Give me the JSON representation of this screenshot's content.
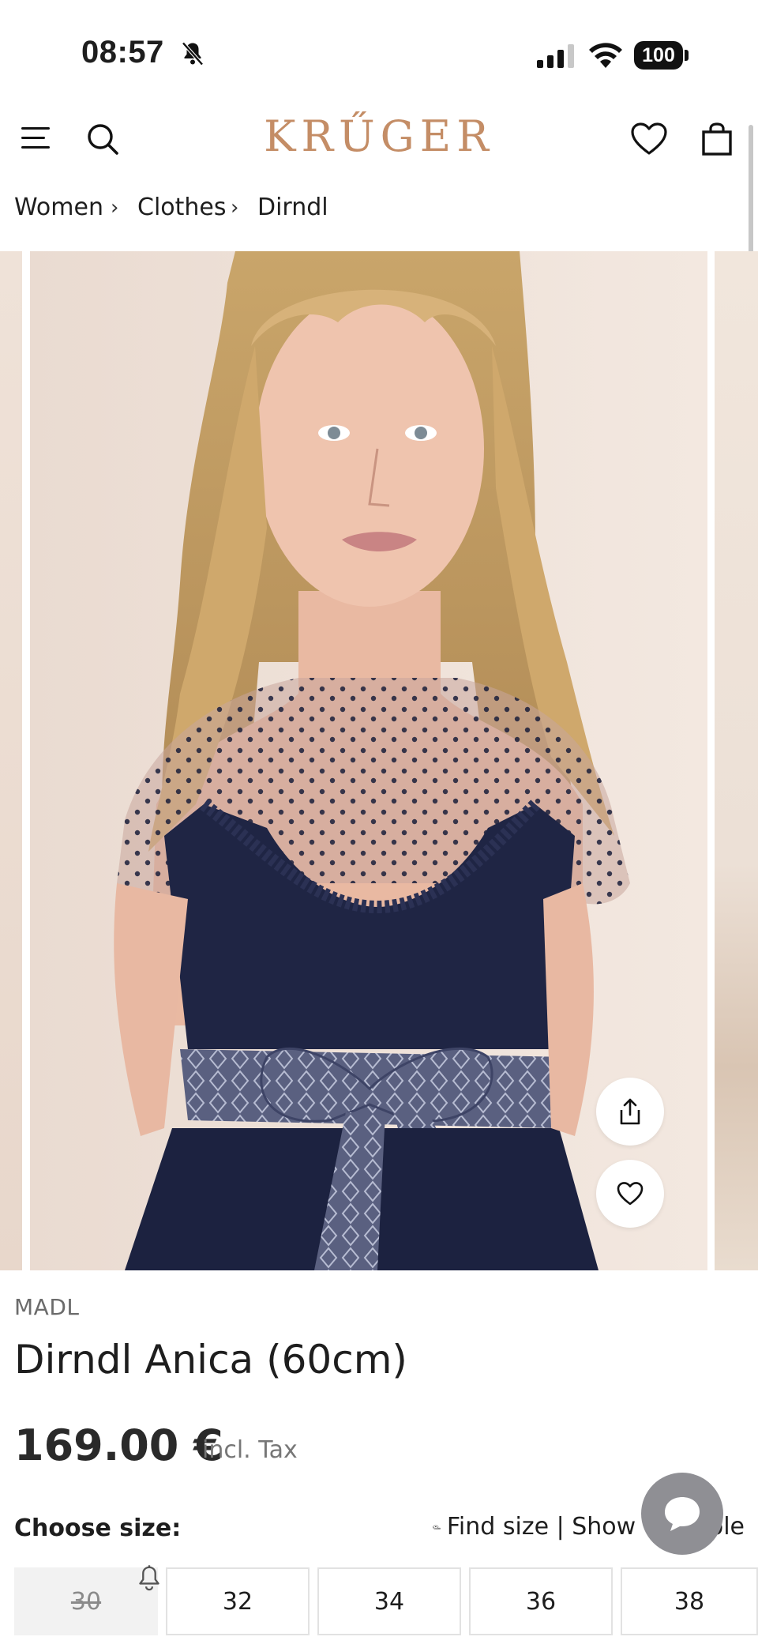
{
  "status_bar": {
    "time": "08:57",
    "battery": "100"
  },
  "header": {
    "logo": "KRŰGER"
  },
  "breadcrumb": {
    "items": [
      "Women",
      "Clothes",
      "Dirndl"
    ],
    "separator": "›"
  },
  "product": {
    "brand": "MADL",
    "title": "Dirndl Anica (60cm)",
    "price": "169.00 €",
    "tax_note": "incl. Tax"
  },
  "sizes": {
    "label": "Choose size:",
    "find_size": "Find size | Show",
    "table_suffix": "ble",
    "options": [
      {
        "label": "30",
        "available": false
      },
      {
        "label": "32",
        "available": true
      },
      {
        "label": "34",
        "available": true
      },
      {
        "label": "36",
        "available": true
      },
      {
        "label": "38",
        "available": true
      }
    ]
  },
  "colors": {
    "logo": "#c48d66",
    "dress": "#1f2544",
    "chat_fab": "#8f8f94"
  }
}
